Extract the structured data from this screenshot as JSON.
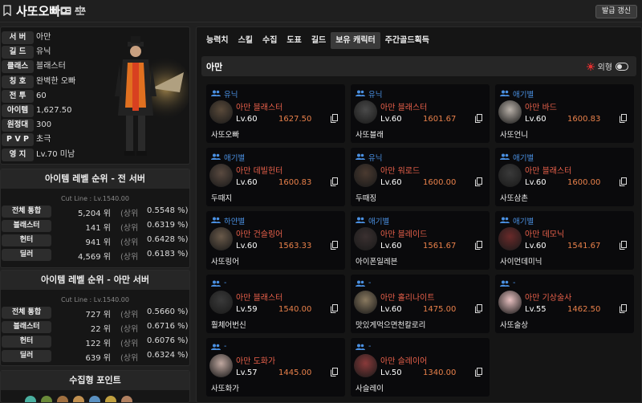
{
  "header": {
    "name": "사또오빠",
    "refresh_label": "발급 갱신"
  },
  "profile": [
    {
      "label": "서 버",
      "value": "아만"
    },
    {
      "label": "길 드",
      "value": "유닉"
    },
    {
      "label": "클래스",
      "value": "블래스터"
    },
    {
      "label": "칭 호",
      "value": "완벽한 오빠"
    },
    {
      "label": "전 투",
      "value": "60"
    },
    {
      "label": "아이템",
      "value": "1,627.50"
    },
    {
      "label": "원정대",
      "value": "300"
    },
    {
      "label": "P V P",
      "value": "초극"
    },
    {
      "label": "영 지",
      "value": "Lv.70 미남"
    }
  ],
  "rank_all": {
    "title": "아이템 레벨 순위 - 전 서버",
    "cutline": "Cut Line : Lv.1540.00",
    "rows": [
      {
        "label": "전체 통합",
        "rank": "5,204 위",
        "sang": "(상위",
        "pct": "0.5548 %)"
      },
      {
        "label": "블래스터",
        "rank": "141 위",
        "sang": "(상위",
        "pct": "0.6319 %)"
      },
      {
        "label": "헌터",
        "rank": "941 위",
        "sang": "(상위",
        "pct": "0.6428 %)"
      },
      {
        "label": "딜러",
        "rank": "4,569 위",
        "sang": "(상위",
        "pct": "0.6183 %)"
      }
    ]
  },
  "rank_server": {
    "title": "아이템 레벨 순위 - 아만 서버",
    "cutline": "Cut Line : Lv.1540.00",
    "rows": [
      {
        "label": "전체 통합",
        "rank": "727 위",
        "sang": "(상위",
        "pct": "0.5660 %)"
      },
      {
        "label": "블래스터",
        "rank": "22 위",
        "sang": "(상위",
        "pct": "0.6716 %)"
      },
      {
        "label": "헌터",
        "rank": "122 위",
        "sang": "(상위",
        "pct": "0.6076 %)"
      },
      {
        "label": "딜러",
        "rank": "639 위",
        "sang": "(상위",
        "pct": "0.6324 %)"
      }
    ]
  },
  "collect": {
    "title": "수집형 포인트"
  },
  "tabs": [
    "능력치",
    "스킬",
    "수집",
    "도표",
    "길드",
    "보유 캐릭터",
    "주간골드획득"
  ],
  "active_tab": 5,
  "server_bar": {
    "name": "아만",
    "appearance_label": "외형"
  },
  "characters": [
    {
      "guild": "유닉",
      "class": "아만  블래스터",
      "level": "Lv.60",
      "ilvl": "1627.50",
      "name": "사또오빠",
      "avatar": "#5a4a3a"
    },
    {
      "guild": "유닉",
      "class": "아만  블래스터",
      "level": "Lv.60",
      "ilvl": "1601.67",
      "name": "사또블래",
      "avatar": "#4a4a4a"
    },
    {
      "guild": "애기별",
      "class": "아만  바드",
      "level": "Lv.60",
      "ilvl": "1600.83",
      "name": "사또언니",
      "avatar": "#b8b0a8"
    },
    {
      "guild": "애기별",
      "class": "아만  데빌헌터",
      "level": "Lv.60",
      "ilvl": "1600.83",
      "name": "두때지",
      "avatar": "#5a4a40"
    },
    {
      "guild": "유닉",
      "class": "아만  워로드",
      "level": "Lv.60",
      "ilvl": "1600.00",
      "name": "두때징",
      "avatar": "#4a3a30"
    },
    {
      "guild": "애기별",
      "class": "아만  블래스터",
      "level": "Lv.60",
      "ilvl": "1600.00",
      "name": "사또삼촌",
      "avatar": "#3a3a3a"
    },
    {
      "guild": "하얀별",
      "class": "아만  건슬링어",
      "level": "Lv.60",
      "ilvl": "1563.33",
      "name": "사또링어",
      "avatar": "#6a5a4a"
    },
    {
      "guild": "애기별",
      "class": "아만  블레이드",
      "level": "Lv.60",
      "ilvl": "1561.67",
      "name": "아이폰일레븐",
      "avatar": "#3a3030"
    },
    {
      "guild": "애기별",
      "class": "아만  데모닉",
      "level": "Lv.60",
      "ilvl": "1541.67",
      "name": "사이먼데미닉",
      "avatar": "#6a2a2a"
    },
    {
      "guild": "-",
      "class": "아만  블래스터",
      "level": "Lv.59",
      "ilvl": "1540.00",
      "name": "훨체어번신",
      "avatar": "#3a3a3a"
    },
    {
      "guild": "-",
      "class": "아만  홀리나이트",
      "level": "Lv.60",
      "ilvl": "1475.00",
      "name": "맛있게먹으면천칼로리",
      "avatar": "#8a7a60"
    },
    {
      "guild": "-",
      "class": "아만  기상술사",
      "level": "Lv.55",
      "ilvl": "1462.50",
      "name": "사또술상",
      "avatar": "#e8c0c0"
    },
    {
      "guild": "-",
      "class": "아만  도화가",
      "level": "Lv.57",
      "ilvl": "1445.00",
      "name": "사또화가",
      "avatar": "#c0a8a0"
    },
    {
      "guild": "-",
      "class": "아만  슬레이어",
      "level": "Lv.50",
      "ilvl": "1340.00",
      "name": "사슬레이",
      "avatar": "#8a3a3a"
    }
  ]
}
